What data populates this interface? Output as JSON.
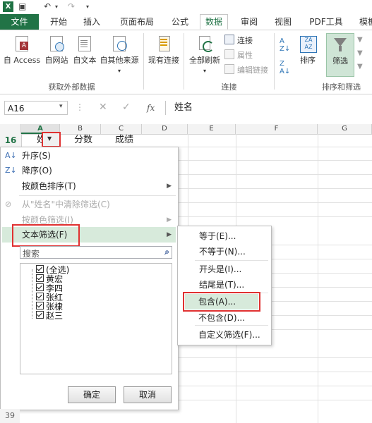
{
  "tabs": [
    "文件",
    "开始",
    "插入",
    "页面布局",
    "公式",
    "数据",
    "审阅",
    "视图",
    "PDF工具",
    "模板"
  ],
  "ribbon": {
    "get_external_data": [
      "自 Access",
      "自网站",
      "自文本",
      "自其他来源"
    ],
    "existing_connection": "现有连接",
    "refresh_all": "全部刷新",
    "connections": "连接",
    "properties": "属性",
    "edit_links": "编辑链接",
    "sort": "排序",
    "filter": "筛选",
    "group_external": "获取外部数据",
    "group_connections": "连接",
    "group_sort_filter": "排序和筛选"
  },
  "formula": {
    "namebox": "A16",
    "fx": "fx",
    "content": "姓名"
  },
  "columns": [
    "A",
    "B",
    "C",
    "D",
    "E",
    "F",
    "G"
  ],
  "row": {
    "number": "16",
    "cells": [
      "姓",
      "分数",
      "成绩"
    ]
  },
  "row_bottom": "39",
  "menu": {
    "sort_asc": "升序(S)",
    "sort_desc": "降序(O)",
    "sort_color": "按颜色排序(T)",
    "clear_filter": "从\"姓名\"中清除筛选(C)",
    "filter_color": "按颜色筛选(I)",
    "text_filter": "文本筛选(F)",
    "search_placeholder": "搜索",
    "items": [
      "(全选)",
      "黄宏",
      "李四",
      "张红",
      "张棣",
      "赵三"
    ],
    "ok": "确定",
    "cancel": "取消"
  },
  "submenu": [
    "等于(E)...",
    "不等于(N)...",
    "开头是(I)...",
    "结尾是(T)...",
    "包含(A)...",
    "不包含(D)...",
    "自定义筛选(F)..."
  ],
  "colors": {
    "excel_green": "#217346",
    "highlight": "#e03131",
    "selected_bg": "#d7eadb"
  }
}
